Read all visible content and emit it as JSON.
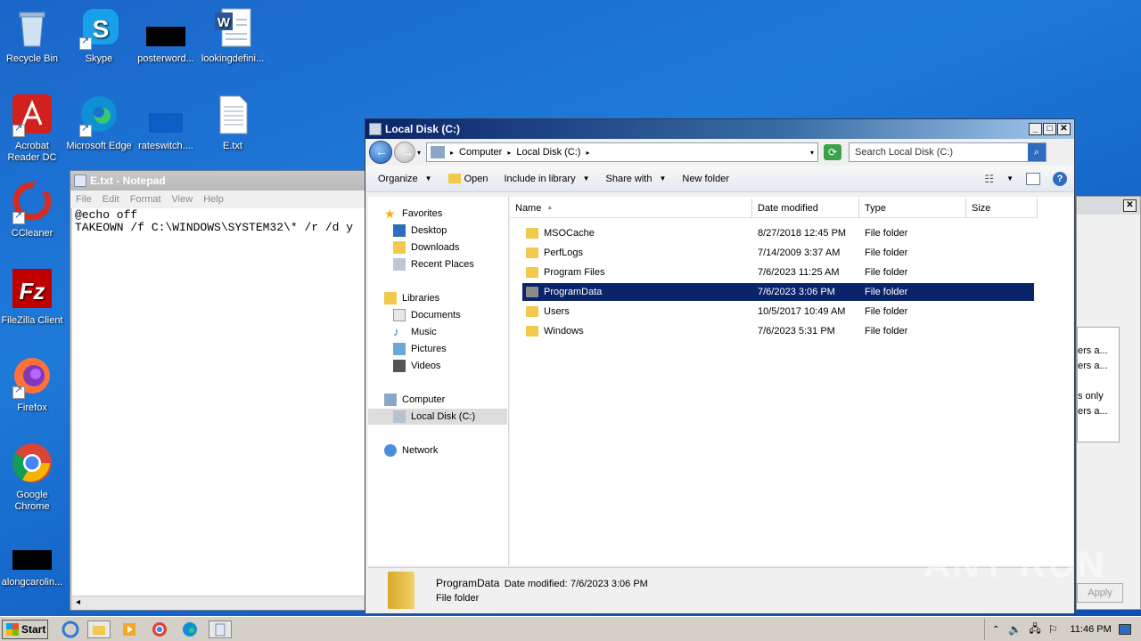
{
  "desktop": {
    "icons": [
      {
        "label": "Recycle Bin"
      },
      {
        "label": "Skype"
      },
      {
        "label": "posterword..."
      },
      {
        "label": "lookingdefini..."
      },
      {
        "label": "Acrobat Reader DC"
      },
      {
        "label": "Microsoft Edge"
      },
      {
        "label": "rateswitch...."
      },
      {
        "label": "E.txt"
      },
      {
        "label": "CCleaner"
      },
      {
        "label": "FileZilla Client"
      },
      {
        "label": "Firefox"
      },
      {
        "label": "Google Chrome"
      },
      {
        "label": "alongcarolin..."
      }
    ]
  },
  "notepad": {
    "title": "E.txt - Notepad",
    "menu": [
      "File",
      "Edit",
      "Format",
      "View",
      "Help"
    ],
    "content": "@echo off\nTAKEOWN /f C:\\WINDOWS\\SYSTEM32\\* /r /d y"
  },
  "bgdialog": {
    "lines": [
      "ers a...",
      "ers a...",
      "s only",
      "ers a..."
    ],
    "apply_label": "Apply"
  },
  "explorer": {
    "title": "Local Disk (C:)",
    "address": [
      "Computer",
      "Local Disk (C:)"
    ],
    "search_placeholder": "Search Local Disk (C:)",
    "toolbar": {
      "organize": "Organize",
      "open": "Open",
      "include": "Include in library",
      "share": "Share with",
      "newfolder": "New folder"
    },
    "nav": {
      "favorites": "Favorites",
      "desktop": "Desktop",
      "downloads": "Downloads",
      "recent": "Recent Places",
      "libraries": "Libraries",
      "documents": "Documents",
      "music": "Music",
      "pictures": "Pictures",
      "videos": "Videos",
      "computer": "Computer",
      "localdisk": "Local Disk (C:)",
      "network": "Network"
    },
    "columns": {
      "name": "Name",
      "date": "Date modified",
      "type": "Type",
      "size": "Size"
    },
    "rows": [
      {
        "name": "MSOCache",
        "date": "8/27/2018 12:45 PM",
        "type": "File folder"
      },
      {
        "name": "PerfLogs",
        "date": "7/14/2009 3:37 AM",
        "type": "File folder"
      },
      {
        "name": "Program Files",
        "date": "7/6/2023 11:25 AM",
        "type": "File folder"
      },
      {
        "name": "ProgramData",
        "date": "7/6/2023 3:06 PM",
        "type": "File folder"
      },
      {
        "name": "Users",
        "date": "10/5/2017 10:49 AM",
        "type": "File folder"
      },
      {
        "name": "Windows",
        "date": "7/6/2023 5:31 PM",
        "type": "File folder"
      }
    ],
    "selected_index": 3,
    "status": {
      "name": "ProgramData",
      "date_label": "Date modified:",
      "date": "7/6/2023 3:06 PM",
      "type": "File folder"
    }
  },
  "taskbar": {
    "start": "Start",
    "clock": "11:46 PM"
  },
  "watermark": "ANY RUN",
  "colors": {
    "selection": "#0a246a",
    "folder": "#f2c94c",
    "title_active": "#0a246a"
  }
}
